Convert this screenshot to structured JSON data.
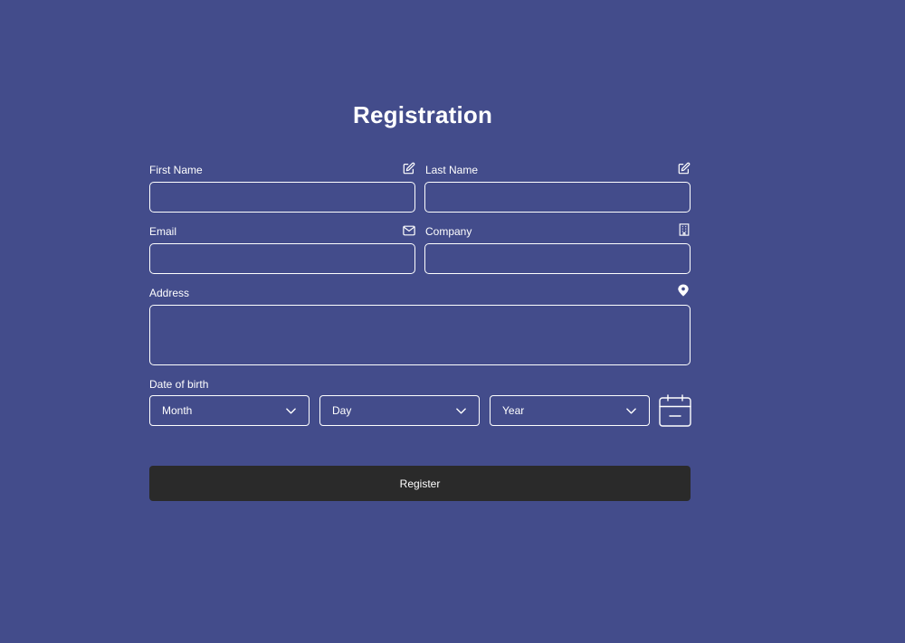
{
  "form": {
    "title": "Registration",
    "first_name": {
      "label": "First Name",
      "icon": "edit-icon",
      "value": ""
    },
    "last_name": {
      "label": "Last Name",
      "icon": "edit-icon",
      "value": ""
    },
    "email": {
      "label": "Email",
      "icon": "mail-icon",
      "value": ""
    },
    "company": {
      "label": "Company",
      "icon": "building-icon",
      "value": ""
    },
    "address": {
      "label": "Address",
      "icon": "location-pin-icon",
      "value": ""
    },
    "dob": {
      "label": "Date of birth",
      "month": "Month",
      "day": "Day",
      "year": "Year",
      "icon": "calendar-icon"
    },
    "submit_label": "Register"
  },
  "colors": {
    "background": "#434c8b",
    "text": "#ffffff",
    "button": "#2a2a2a"
  }
}
